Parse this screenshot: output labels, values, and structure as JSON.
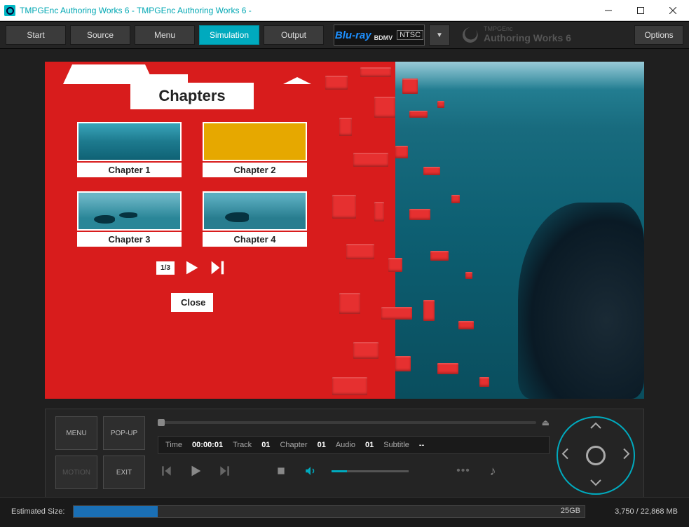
{
  "window": {
    "title": "TMPGEnc Authoring Works 6 - TMPGEnc Authoring Works 6 -"
  },
  "nav": {
    "start": "Start",
    "source": "Source",
    "menu": "Menu",
    "simulation": "Simulation",
    "output": "Output"
  },
  "format": {
    "bluray": "Blu-ray",
    "bdmv": "BDMV",
    "std": "NTSC"
  },
  "brand": {
    "line1": "TMPGEnc",
    "line2": "Authoring Works 6"
  },
  "options": "Options",
  "chapters": {
    "heading": "Chapters",
    "items": [
      "Chapter 1",
      "Chapter 2",
      "Chapter 3",
      "Chapter 4"
    ],
    "page": "1/3",
    "close": "Close"
  },
  "menu_buttons": {
    "menu": "MENU",
    "popup": "POP-UP",
    "motion": "MOTION",
    "exit": "EXIT"
  },
  "info": {
    "time_label": "Time",
    "time": "00:00:01",
    "track_label": "Track",
    "track": "01",
    "chapter_label": "Chapter",
    "chapter": "01",
    "audio_label": "Audio",
    "audio": "01",
    "subtitle_label": "Subtitle",
    "subtitle": "--"
  },
  "estimated": {
    "label": "Estimated Size:",
    "capacity": "25GB",
    "total": "3,750 / 22,868 MB"
  }
}
